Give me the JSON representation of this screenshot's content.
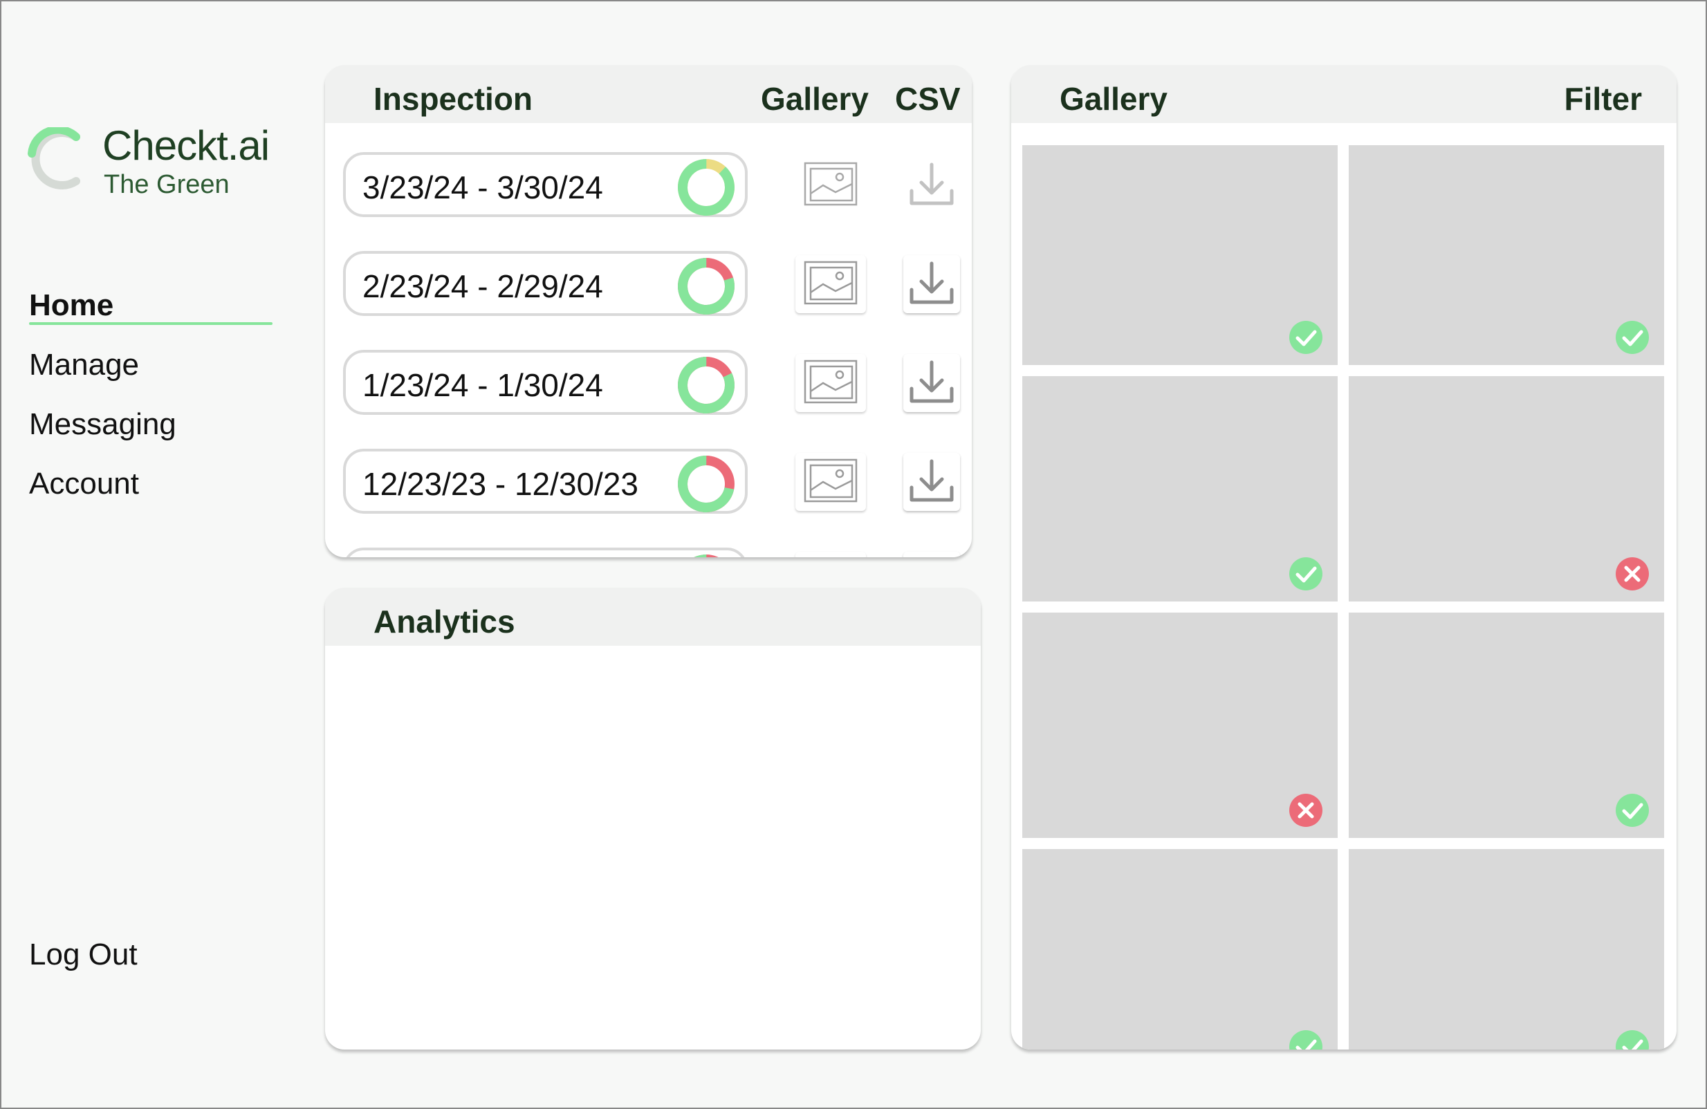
{
  "brand": {
    "name": "Checkt.ai",
    "subtitle": "The Green"
  },
  "nav": {
    "items": [
      {
        "label": "Home",
        "active": true
      },
      {
        "label": "Manage",
        "active": false
      },
      {
        "label": "Messaging",
        "active": false
      },
      {
        "label": "Account",
        "active": false
      }
    ],
    "logout": "Log Out"
  },
  "inspection": {
    "title": "Inspection",
    "col_gallery": "Gallery",
    "col_csv": "CSV",
    "rows": [
      {
        "range": "3/23/24 - 3/30/24",
        "status_fraction": 0.88,
        "status_color": "#ecdc84",
        "enabled": false
      },
      {
        "range": "2/23/24 - 2/29/24",
        "status_fraction": 0.8,
        "status_color": "#ec6b78",
        "enabled": true
      },
      {
        "range": "1/23/24 - 1/30/24",
        "status_fraction": 0.82,
        "status_color": "#ec6b78",
        "enabled": true
      },
      {
        "range": "12/23/23 - 12/30/23",
        "status_fraction": 0.72,
        "status_color": "#ec6b78",
        "enabled": true
      },
      {
        "range": "",
        "status_fraction": 0.8,
        "status_color": "#ec6b78",
        "enabled": true
      }
    ]
  },
  "analytics": {
    "title": "Analytics"
  },
  "gallery": {
    "title": "Gallery",
    "filter_label": "Filter",
    "tiles": [
      {
        "status": "pass"
      },
      {
        "status": "pass"
      },
      {
        "status": "pass"
      },
      {
        "status": "fail"
      },
      {
        "status": "fail"
      },
      {
        "status": "pass"
      },
      {
        "status": "pass"
      },
      {
        "status": "pass"
      }
    ]
  },
  "colors": {
    "accent_green": "#86e59b",
    "fail_red": "#ec6b78",
    "pending_yellow": "#ecdc84",
    "tile_gray": "#d9d9d9"
  }
}
